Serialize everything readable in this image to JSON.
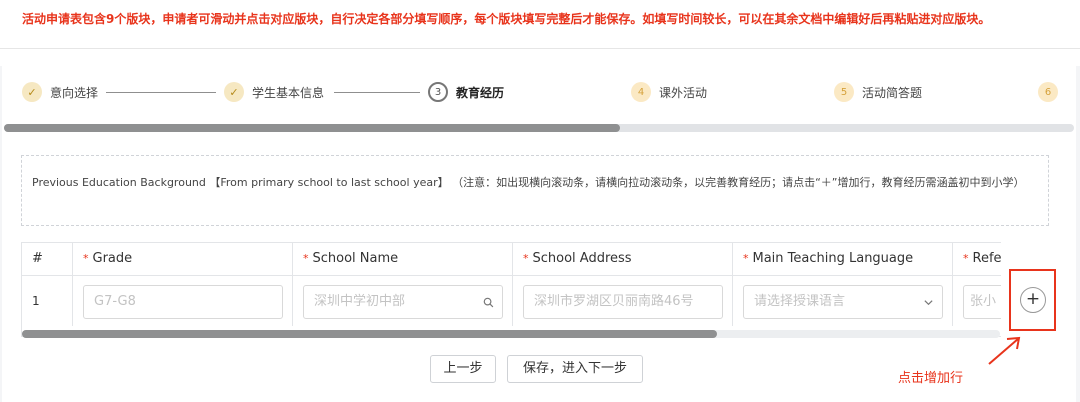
{
  "notice": "活动申请表包含9个版块，申请者可滑动并点击对应版块，自行决定各部分填写顺序，每个版块填写完整后才能保存。如填写时间较长，可以在其余文档中编辑好后再粘贴进对应版块。",
  "steps": [
    {
      "index": "1",
      "label": "意向选择",
      "state": "done",
      "icon": "check-icon"
    },
    {
      "index": "2",
      "label": "学生基本信息",
      "state": "done",
      "icon": "check-icon"
    },
    {
      "index": "3",
      "label": "教育经历",
      "state": "current"
    },
    {
      "index": "4",
      "label": "课外活动",
      "state": "todo"
    },
    {
      "index": "5",
      "label": "活动简答题",
      "state": "todo"
    },
    {
      "index": "6",
      "label": "",
      "state": "todo"
    }
  ],
  "education_note": {
    "prefix": "Previous Education Background 【From primary school to last school year】",
    "hint": "（注意：如出现横向滚动条，请横向拉动滚动条，以完善教育经历；请点击“＋”增加行，教育经历需涵盖初中到小学）"
  },
  "table": {
    "columns": [
      {
        "label": "#",
        "required": false
      },
      {
        "label": "Grade",
        "required": true
      },
      {
        "label": "School Name",
        "required": true
      },
      {
        "label": "School Address",
        "required": true
      },
      {
        "label": "Main Teaching Language",
        "required": true
      },
      {
        "label": "Refe",
        "required": true
      }
    ],
    "required_mark": "*",
    "rows": [
      {
        "num": "1",
        "grade_placeholder": "G7-G8",
        "school_name_placeholder": "深圳中学初中部",
        "school_address_placeholder": "深圳市罗湖区贝丽南路46号",
        "language_placeholder": "请选择授课语言",
        "ref_placeholder": "张小"
      }
    ]
  },
  "icons": {
    "search": "search-icon",
    "dropdown": "chevron-down-icon",
    "add": "plus-icon"
  },
  "add_glyph": "+",
  "buttons": {
    "prev": "上一步",
    "save_next": "保存，进入下一步"
  },
  "annotation": "点击增加行",
  "colors": {
    "notice_red": "#e8341c",
    "step_done_bg": "#f6e8c2",
    "step_todo_bg": "#fbe9c4"
  }
}
